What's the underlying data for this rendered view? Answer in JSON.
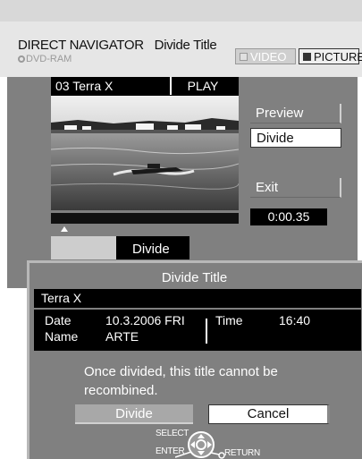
{
  "header": {
    "app_title": "DIRECT NAVIGATOR",
    "screen_title": "Divide Title",
    "media_label": "DVD-RAM",
    "modes": [
      {
        "label": "VIDEO",
        "selected": false
      },
      {
        "label": "PICTURE",
        "selected": true
      }
    ]
  },
  "preview": {
    "title_label": "03 Terra X",
    "state_label": "PLAY",
    "timecode": "0:00.35"
  },
  "side_menu": {
    "preview_label": "Preview",
    "divide_label": "Divide",
    "exit_label": "Exit"
  },
  "tab": {
    "divide_label": "Divide"
  },
  "dialog": {
    "title": "Divide Title",
    "program_name": "Terra X",
    "date_label": "Date",
    "date_value": "10.3.2006 FRI",
    "time_label": "Time",
    "time_value": "16:40",
    "name_label": "Name",
    "name_value": "ARTE",
    "message_line1": "Once divided, this title cannot be",
    "message_line2": "recombined.",
    "divide_button": "Divide",
    "cancel_button": "Cancel"
  },
  "controls": {
    "select_label": "SELECT",
    "enter_label": "ENTER",
    "return_label": "RETURN"
  },
  "colors": {
    "panel_gray": "#808080",
    "header_gray": "#e6e6e6",
    "highlight": "#ffffff"
  }
}
